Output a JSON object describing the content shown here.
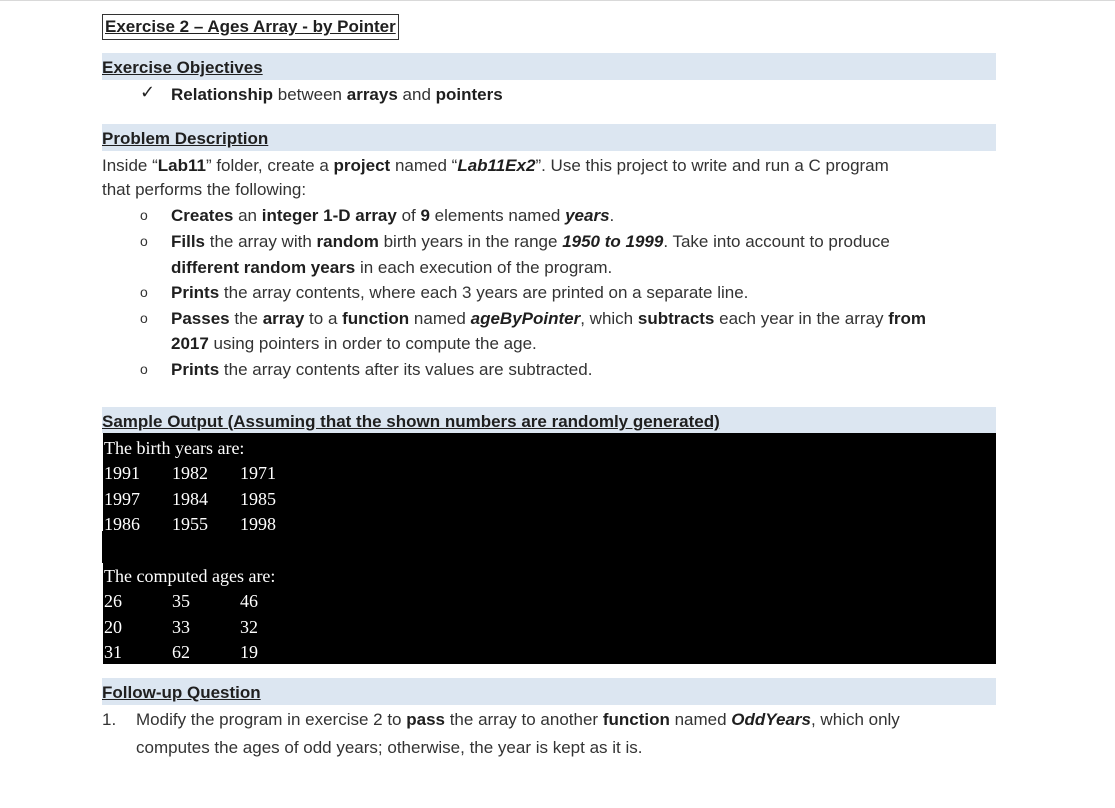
{
  "title": "Exercise 2 – Ages Array - by Pointer",
  "objectives": {
    "heading": "Exercise Objectives",
    "check": "✓",
    "item": {
      "p1": "Relationship",
      "p2": " between ",
      "p3": "arrays",
      "p4": " and ",
      "p5": "pointers"
    }
  },
  "problem": {
    "heading": "Problem Description",
    "intro1": {
      "p1": "Inside “",
      "p2": "Lab11",
      "p3": "” folder, create a ",
      "p4": "project",
      "p5": " named “",
      "p6": "Lab11Ex2",
      "p7": "”. Use this project to write and run a C program"
    },
    "intro2": "that performs the following:",
    "bullet": "o",
    "b1": {
      "p1": "Creates",
      "p2": " an ",
      "p3": "integer 1-D array",
      "p4": " of ",
      "p5": "9",
      "p6": " elements named ",
      "p7": "years",
      "p8": "."
    },
    "b2a": {
      "p1": "Fills",
      "p2": " the array with ",
      "p3": "random",
      "p4": " birth years in the range ",
      "p5": "1950 to 1999",
      "p6": ". Take into account to produce"
    },
    "b2b": {
      "p1": "different random years",
      "p2": " in each execution of the program."
    },
    "b3": {
      "p1": "Prints",
      "p2": " the array contents, where each 3 years are printed on a separate line."
    },
    "b4a": {
      "p1": "Passes",
      "p2": " the ",
      "p3": "array",
      "p4": " to a ",
      "p5": "function",
      "p6": " named ",
      "p7": "ageByPointer",
      "p8": ", which ",
      "p9": "subtracts",
      "p10": " each year in the array ",
      "p11": "from"
    },
    "b4b": {
      "p1": "2017",
      "p2": " using pointers in order to compute the age."
    },
    "b5": {
      "p1": "Prints",
      "p2": " the array contents after its values are subtracted."
    }
  },
  "sample": {
    "heading": "Sample Output (Assuming that the shown numbers are randomly generated)",
    "birth_label": "The birth years are:",
    "birth_rows": [
      [
        "1991",
        "1982",
        "1971"
      ],
      [
        "1997",
        "1984",
        "1985"
      ],
      [
        "1986",
        "1955",
        "1998"
      ]
    ],
    "ages_label": "The computed ages are:",
    "age_rows": [
      [
        "26",
        "35",
        "46"
      ],
      [
        "20",
        "33",
        "32"
      ],
      [
        "31",
        "62",
        "19"
      ]
    ]
  },
  "followup": {
    "heading": "Follow-up Question",
    "number": "1.",
    "q1": {
      "p1": "Modify the program in exercise 2 to ",
      "p2": "pass",
      "p3": " the array to another ",
      "p4": "function",
      "p5": " named ",
      "p6": "OddYears",
      "p7": ", which only"
    },
    "q2": "computes the ages of odd years; otherwise, the year is kept as it is."
  }
}
